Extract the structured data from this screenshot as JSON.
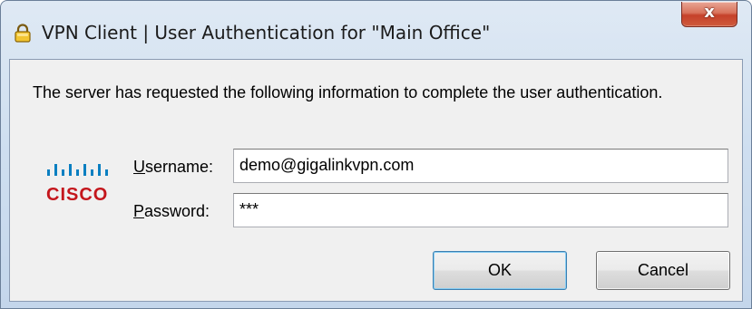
{
  "window": {
    "title": "VPN Client  |  User Authentication for \"Main Office\"",
    "close_label": "x",
    "close_icon": "close-icon"
  },
  "dialog": {
    "message": "The server has requested the following information to complete the user authentication."
  },
  "logo": {
    "icon": "cisco-logo",
    "text": "CISCO",
    "color": "#c4161c"
  },
  "form": {
    "username": {
      "label_mnemonic": "U",
      "label_rest": "sername:",
      "value": "demo@gigalinkvpn.com"
    },
    "password": {
      "label_mnemonic": "P",
      "label_rest": "assword:",
      "value": "***"
    }
  },
  "buttons": {
    "ok": "OK",
    "cancel": "Cancel"
  },
  "colors": {
    "accent": "#3c7fb1",
    "close_button": "#c5412a"
  }
}
